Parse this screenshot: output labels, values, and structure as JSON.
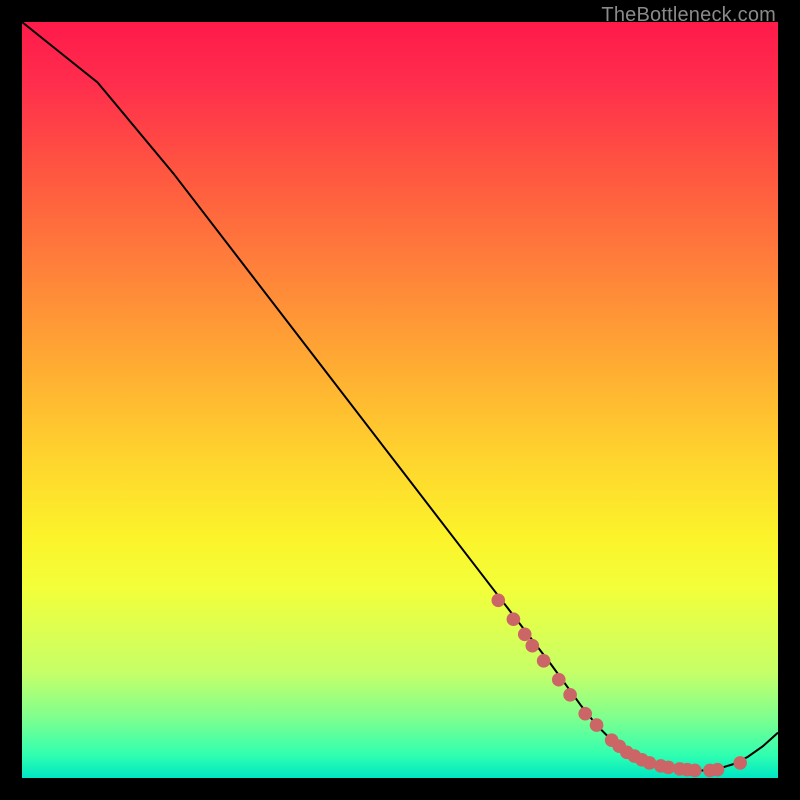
{
  "attribution": "TheBottleneck.com",
  "chart_data": {
    "type": "line",
    "title": "",
    "xlabel": "",
    "ylabel": "",
    "xlim": [
      0,
      100
    ],
    "ylim": [
      0,
      100
    ],
    "grid": false,
    "legend": false,
    "series": [
      {
        "name": "curve",
        "color": "#000000",
        "x": [
          0,
          5,
          10,
          20,
          30,
          40,
          50,
          60,
          65,
          70,
          74,
          76,
          78,
          80,
          82,
          84,
          86,
          88,
          90,
          92,
          94,
          96,
          98,
          100
        ],
        "y": [
          100,
          96,
          92,
          80,
          67,
          54,
          41,
          28,
          21.5,
          15,
          9.5,
          7,
          5,
          3.4,
          2.3,
          1.6,
          1.2,
          1.0,
          1.0,
          1.2,
          1.8,
          2.8,
          4.2,
          6
        ]
      },
      {
        "name": "markers",
        "type": "scatter",
        "color": "#cc6666",
        "x": [
          63,
          65,
          66.5,
          67.5,
          69,
          71,
          72.5,
          74.5,
          76,
          78,
          79,
          80,
          81,
          82,
          83,
          84.5,
          85.5,
          87,
          88,
          89,
          91,
          92,
          95
        ],
        "y": [
          23.5,
          21,
          19,
          17.5,
          15.5,
          13,
          11,
          8.5,
          7,
          5,
          4.2,
          3.4,
          2.9,
          2.4,
          2.0,
          1.6,
          1.4,
          1.2,
          1.1,
          1.0,
          1.0,
          1.1,
          2.0
        ]
      }
    ]
  }
}
